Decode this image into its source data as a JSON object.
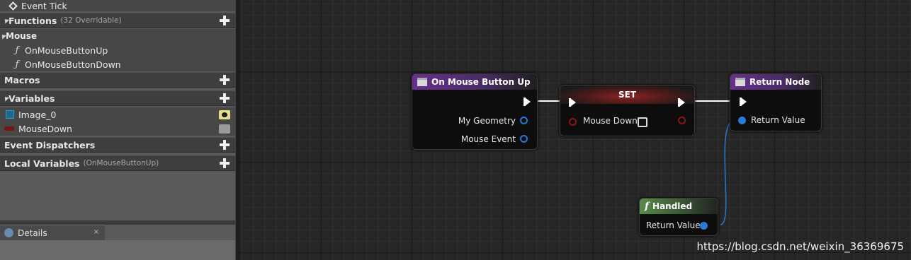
{
  "sidebar": {
    "event_tick": "Event Tick",
    "functions": {
      "label": "Functions",
      "count": "(32 Overridable)"
    },
    "mouse_category": "Mouse",
    "mouse_functions": [
      "OnMouseButtonUp",
      "OnMouseButtonDown"
    ],
    "macros": {
      "label": "Macros"
    },
    "variables": {
      "label": "Variables",
      "items": [
        "Image_0",
        "MouseDown"
      ]
    },
    "event_dispatchers": {
      "label": "Event Dispatchers"
    },
    "local_variables": {
      "label": "Local Variables",
      "scope": "(OnMouseButtonUp)"
    }
  },
  "details_tab": {
    "label": "Details",
    "close": "×"
  },
  "graph": {
    "nodes": {
      "on_mouse_button_up": {
        "title": "On Mouse Button Up",
        "pins": [
          "My Geometry",
          "Mouse Event"
        ]
      },
      "set": {
        "title": "SET",
        "pins": [
          "Mouse Down"
        ]
      },
      "return_node": {
        "title": "Return Node",
        "pins": [
          "Return Value"
        ]
      },
      "handled": {
        "title": "Handled",
        "pins": [
          "Return Value"
        ]
      }
    },
    "watermark": "https://blog.csdn.net/weixin_36369675"
  },
  "colors": {
    "function_title": "#6a2f8e",
    "pure_function_title": "#5a8a4a",
    "set_title": "#8a2424",
    "struct_pin": "#2a78d8",
    "bool_pin": "#8b1616"
  },
  "icons": {
    "event": "diamond-icon",
    "function": "function-icon",
    "add": "plus-icon",
    "visibility": "eye-icon",
    "details": "info-icon"
  }
}
